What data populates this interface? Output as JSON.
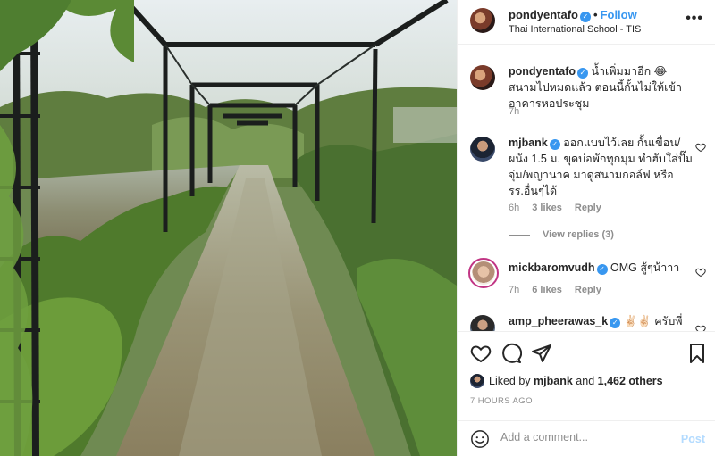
{
  "post": {
    "username": "pondyentafo",
    "follow_label": "Follow",
    "location": "Thai International School - TIS",
    "more_label": "•••"
  },
  "comments": [
    {
      "username": "pondyentafo",
      "text": "น้ำเพิ่มมาอีก 😂 สนามไปหมดแล้ว ตอนนี้กั้นไม่ให้เข้าอาคารหอประชุม",
      "time": "7h",
      "likes": "",
      "reply": ""
    },
    {
      "username": "mjbank",
      "text": "ออกแบบไว้เลย กั้นเขื่อน/ผนัง 1.5 ม. ขุดบ่อพักทุกมุม ทำฮับใส่ปั๊ม จุ่ม/พญานาค มาดูสนามกอล์ฟ หรือ รร.อื่นๆได้",
      "time": "6h",
      "likes": "3 likes",
      "reply": "Reply",
      "view_replies": "View replies (3)"
    },
    {
      "username": "mickbaromvudh",
      "text": "OMG สู้ๆน้าาา",
      "time": "7h",
      "likes": "6 likes",
      "reply": "Reply"
    },
    {
      "username": "amp_pheerawas_k",
      "text": "✌🏻✌🏻 ครับพี่",
      "time": "",
      "likes": "",
      "reply": ""
    }
  ],
  "likes_summary": {
    "prefix": "Liked by",
    "user": "mjbank",
    "joiner": "and",
    "others": "1,462 others"
  },
  "timestamp": "7 HOURS AGO",
  "add_comment": {
    "placeholder": "Add a comment...",
    "post_label": "Post"
  },
  "colors": {
    "accent": "#3897f0",
    "text": "#262626",
    "muted": "#8e8e8e",
    "post_disabled": "#b3dbff"
  }
}
